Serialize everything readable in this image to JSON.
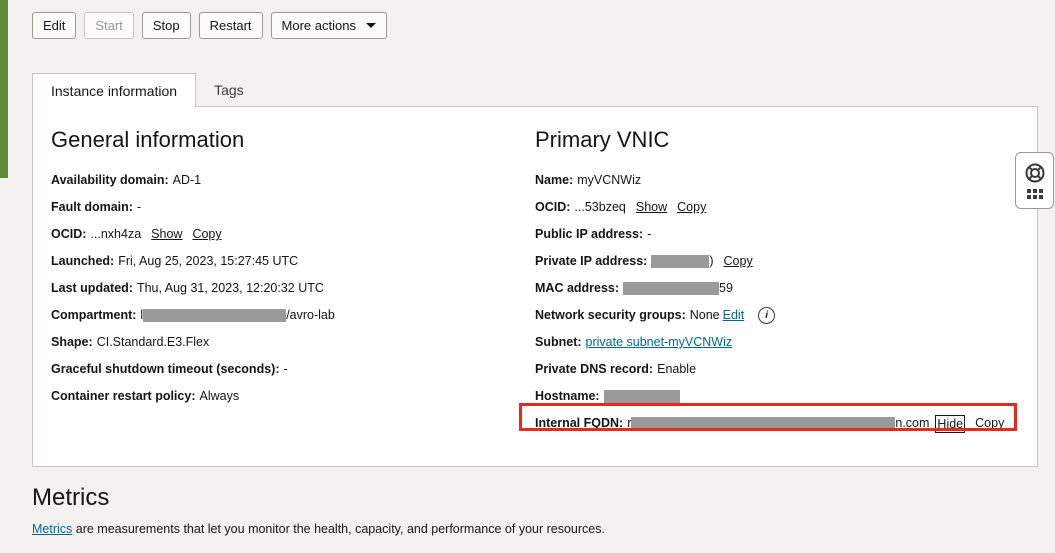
{
  "toolbar": {
    "edit": "Edit",
    "start": "Start",
    "stop": "Stop",
    "restart": "Restart",
    "more_actions": "More actions"
  },
  "tabs": [
    {
      "label": "Instance information"
    },
    {
      "label": "Tags"
    }
  ],
  "general": {
    "title": "General information",
    "availability_domain": {
      "label": "Availability domain:",
      "value": "AD-1"
    },
    "fault_domain": {
      "label": "Fault domain:",
      "value": "-"
    },
    "ocid": {
      "label": "OCID:",
      "value": "...nxh4za",
      "show": "Show",
      "copy": "Copy"
    },
    "launched": {
      "label": "Launched:",
      "value": "Fri, Aug 25, 2023, 15:27:45 UTC"
    },
    "last_updated": {
      "label": "Last updated:",
      "value": "Thu, Aug 31, 2023, 12:20:32 UTC"
    },
    "compartment": {
      "label": "Compartment:",
      "prefix": "l",
      "suffix": "/avro-lab"
    },
    "shape": {
      "label": "Shape:",
      "value": "CI.Standard.E3.Flex"
    },
    "graceful": {
      "label": "Graceful shutdown timeout (seconds):",
      "value": "-"
    },
    "restart_policy": {
      "label": "Container restart policy:",
      "value": "Always"
    }
  },
  "vnic": {
    "title": "Primary VNIC",
    "name": {
      "label": "Name:",
      "value": "myVCNWiz"
    },
    "ocid": {
      "label": "OCID:",
      "value": "...53bzeq",
      "show": "Show",
      "copy": "Copy"
    },
    "public_ip": {
      "label": "Public IP address:",
      "value": "-"
    },
    "private_ip": {
      "label": "Private IP address:",
      "suffix": ")",
      "copy": "Copy"
    },
    "mac": {
      "label": "MAC address:",
      "suffix": "59"
    },
    "nsg": {
      "label": "Network security groups:",
      "value": "None",
      "edit": "Edit",
      "info": "i"
    },
    "subnet": {
      "label": "Subnet:",
      "value": "private subnet-myVCNWiz"
    },
    "private_dns": {
      "label": "Private DNS record:",
      "value": "Enable"
    },
    "hostname": {
      "label": "Hostname:"
    },
    "fqdn": {
      "label": "Internal FQDN:",
      "prefix": "r",
      "suffix": "n.com",
      "hide": "Hide",
      "copy": "Copy"
    }
  },
  "metrics": {
    "title": "Metrics",
    "link": "Metrics",
    "desc": " are measurements that let you monitor the health, capacity, and performance of your resources."
  },
  "colors": {
    "accent_green": "#5f8b3a",
    "highlight_red": "#e8291c",
    "link_blue": "#00688c"
  }
}
